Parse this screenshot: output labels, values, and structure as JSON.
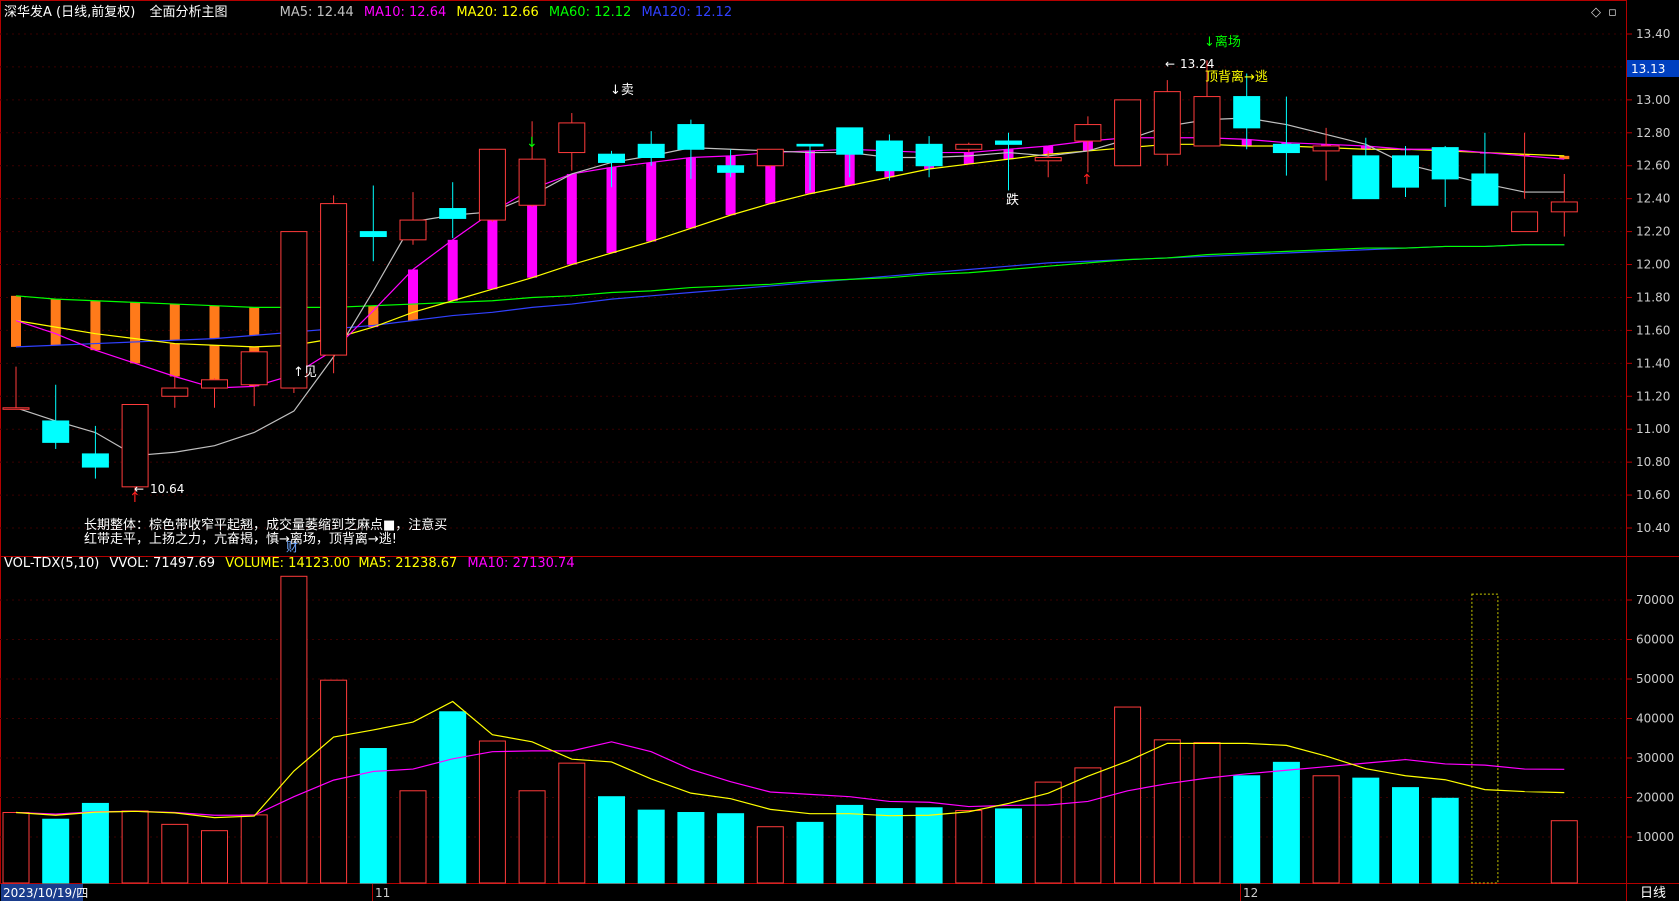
{
  "header": {
    "stock_title": "深华发A (日线,前复权)",
    "main_chart_label": "全面分析主图",
    "ma5": "MA5: 12.44",
    "ma10": "MA10: 12.64",
    "ma20": "MA20: 12.66",
    "ma60": "MA60: 12.12",
    "ma120": "MA120: 12.12"
  },
  "volume_header": {
    "indicator": "VOL-TDX(5,10)",
    "vvol": "VVOL: 71497.69",
    "volume": "VOLUME: 14123.00",
    "ma5": "MA5: 21238.67",
    "ma10": "MA10: 27130.74"
  },
  "colors": {
    "up": "#ff3b3b",
    "down": "#00ffff",
    "ma5": "#c0c0c0",
    "ma10": "#ff00ff",
    "ma20": "#ffff00",
    "ma60": "#00ff00",
    "ma120": "#3040ff",
    "axis": "#b40000",
    "current_price_bg": "#0040c0"
  },
  "price_axis": {
    "ticks": [
      "13.40",
      "13.20",
      "13.00",
      "12.80",
      "12.60",
      "12.40",
      "12.20",
      "12.00",
      "11.80",
      "11.60",
      "11.40",
      "11.20",
      "11.00",
      "10.80",
      "10.60",
      "10.40"
    ],
    "current_price": "13.13"
  },
  "volume_axis": {
    "ticks": [
      "70000",
      "60000",
      "50000",
      "40000",
      "30000",
      "20000",
      "10000"
    ]
  },
  "annotations": {
    "sell": "↓卖",
    "see": "↑见",
    "leave": "↓离场",
    "high": "13.24",
    "top_divergence": "顶背离→逃",
    "low": "10.64",
    "fall": "跌",
    "finance": "财",
    "tip_line1": "长期整体：棕色带收窄平起翘，成交量萎缩到芝麻点■，注意买",
    "tip_line2": "红带走平，上扬之力，亢奋揭，慎→离场，顶背离→逃!"
  },
  "date_axis": {
    "start_date": "2023/10/19/四",
    "month_nov": "11",
    "month_dec": "12",
    "period": "日线"
  },
  "chart_data": {
    "type": "candlestick",
    "x": [
      "2023-10-19",
      "2023-10-20",
      "2023-10-23",
      "2023-10-24",
      "2023-10-25",
      "2023-10-26",
      "2023-10-27",
      "2023-10-30",
      "2023-10-31",
      "2023-11-01",
      "2023-11-02",
      "2023-11-03",
      "2023-11-06",
      "2023-11-07",
      "2023-11-08",
      "2023-11-09",
      "2023-11-10",
      "2023-11-13",
      "2023-11-14",
      "2023-11-15",
      "2023-11-16",
      "2023-11-17",
      "2023-11-20",
      "2023-11-21",
      "2023-11-22",
      "2023-11-23",
      "2023-11-24",
      "2023-11-27",
      "2023-11-28",
      "2023-11-29",
      "2023-11-30",
      "2023-12-01",
      "2023-12-04",
      "2023-12-05",
      "2023-12-06",
      "2023-12-07",
      "2023-12-08",
      "2023-12-11",
      "2023-12-12",
      "2023-12-13"
    ],
    "open": [
      11.13,
      11.05,
      10.85,
      10.65,
      11.2,
      11.25,
      11.27,
      11.25,
      11.45,
      12.2,
      12.15,
      12.34,
      12.27,
      12.36,
      12.68,
      12.67,
      12.73,
      12.85,
      12.6,
      12.6,
      12.73,
      12.83,
      12.75,
      12.73,
      12.7,
      12.75,
      12.63,
      12.75,
      12.6,
      12.67,
      12.72,
      13.02,
      12.73,
      12.69,
      12.66,
      12.66,
      12.71,
      12.55,
      12.2,
      12.32
    ],
    "high": [
      11.38,
      11.27,
      11.02,
      11.15,
      11.32,
      11.31,
      11.47,
      11.5,
      12.42,
      12.48,
      12.44,
      12.5,
      12.7,
      12.87,
      12.92,
      12.69,
      12.81,
      12.88,
      12.7,
      12.61,
      12.73,
      12.8,
      12.79,
      12.78,
      12.74,
      12.8,
      12.69,
      12.9,
      12.98,
      13.12,
      13.24,
      13.16,
      13.02,
      12.83,
      12.77,
      12.72,
      12.72,
      12.8,
      12.8,
      12.55
    ],
    "low": [
      11.12,
      10.88,
      10.7,
      10.61,
      11.13,
      11.13,
      11.14,
      11.22,
      11.34,
      12.02,
      12.12,
      12.16,
      12.26,
      12.35,
      12.57,
      12.47,
      12.6,
      12.52,
      12.53,
      12.58,
      12.45,
      12.53,
      12.51,
      12.53,
      12.68,
      12.45,
      12.53,
      12.56,
      12.6,
      12.6,
      12.9,
      12.7,
      12.54,
      12.51,
      12.42,
      12.41,
      12.35,
      12.5,
      12.4,
      12.17
    ],
    "close": [
      11.13,
      10.92,
      10.77,
      11.15,
      11.25,
      11.3,
      11.47,
      12.2,
      12.37,
      12.17,
      12.27,
      12.28,
      12.7,
      12.64,
      12.86,
      12.62,
      12.65,
      12.7,
      12.56,
      12.7,
      12.72,
      12.67,
      12.57,
      12.6,
      12.73,
      12.73,
      12.65,
      12.85,
      13.0,
      13.05,
      13.02,
      12.83,
      12.68,
      12.72,
      12.4,
      12.47,
      12.52,
      12.36,
      12.32,
      12.38
    ],
    "volume": [
      16200,
      14500,
      18500,
      16600,
      13200,
      11600,
      15600,
      76000,
      49700,
      32400,
      21700,
      41700,
      34300,
      21700,
      28700,
      20200,
      16800,
      16200,
      15900,
      12600,
      13700,
      18000,
      17200,
      17400,
      16700,
      17100,
      23900,
      27500,
      42900,
      34600,
      33900,
      25500,
      28900,
      25500,
      24900,
      22500,
      19800,
      71497,
      0,
      14123
    ],
    "ma5": [
      11.13,
      11.05,
      10.98,
      10.84,
      10.86,
      10.9,
      10.98,
      11.11,
      11.44,
      11.84,
      12.26,
      12.3,
      12.32,
      12.42,
      12.55,
      12.62,
      12.66,
      12.71,
      12.7,
      12.69,
      12.68,
      12.68,
      12.65,
      12.65,
      12.66,
      12.68,
      12.66,
      12.69,
      12.76,
      12.84,
      12.88,
      12.89,
      12.85,
      12.79,
      12.73,
      12.61,
      12.55,
      12.49,
      12.44,
      12.44
    ],
    "ma10": [
      11.66,
      11.58,
      11.48,
      11.4,
      11.32,
      11.25,
      11.26,
      11.33,
      11.48,
      11.72,
      11.97,
      12.15,
      12.32,
      12.46,
      12.55,
      12.59,
      12.62,
      12.65,
      12.66,
      12.68,
      12.69,
      12.7,
      12.69,
      12.68,
      12.68,
      12.7,
      12.72,
      12.75,
      12.77,
      12.77,
      12.77,
      12.76,
      12.74,
      12.73,
      12.72,
      12.7,
      12.7,
      12.68,
      12.66,
      12.64
    ],
    "ma20": [
      11.66,
      11.62,
      11.58,
      11.55,
      11.52,
      11.51,
      11.5,
      11.51,
      11.55,
      11.62,
      11.71,
      11.78,
      11.85,
      11.92,
      12.0,
      12.07,
      12.14,
      12.22,
      12.3,
      12.37,
      12.43,
      12.48,
      12.53,
      12.58,
      12.61,
      12.64,
      12.67,
      12.69,
      12.71,
      12.73,
      12.73,
      12.72,
      12.72,
      12.71,
      12.7,
      12.7,
      12.69,
      12.68,
      12.67,
      12.66
    ],
    "ma60": [
      11.81,
      11.79,
      11.78,
      11.77,
      11.76,
      11.75,
      11.74,
      11.74,
      11.74,
      11.75,
      11.76,
      11.77,
      11.78,
      11.8,
      11.81,
      11.83,
      11.84,
      11.86,
      11.87,
      11.88,
      11.9,
      11.91,
      11.92,
      11.94,
      11.95,
      11.97,
      11.99,
      12.01,
      12.03,
      12.04,
      12.06,
      12.07,
      12.08,
      12.09,
      12.1,
      12.1,
      12.11,
      12.11,
      12.12,
      12.12
    ],
    "ma120": [
      11.5,
      11.51,
      11.52,
      11.53,
      11.54,
      11.55,
      11.57,
      11.59,
      11.61,
      11.63,
      11.66,
      11.69,
      11.71,
      11.74,
      11.76,
      11.79,
      11.81,
      11.83,
      11.85,
      11.87,
      11.89,
      11.91,
      11.93,
      11.95,
      11.97,
      11.99,
      12.01,
      12.02,
      12.03,
      12.04,
      12.05,
      12.06,
      12.07,
      12.08,
      12.09,
      12.1,
      12.11,
      12.11,
      12.12,
      12.12
    ],
    "vol_ma5": [
      16200,
      15500,
      16300,
      16500,
      16100,
      14900,
      15300,
      26700,
      35300,
      37100,
      39100,
      44300,
      35900,
      34100,
      29700,
      29000,
      24700,
      21100,
      19700,
      17000,
      15900,
      15900,
      15400,
      15500,
      16400,
      18500,
      21100,
      25400,
      29200,
      33700,
      33700,
      33700,
      33200,
      30500,
      27300,
      25500,
      24500,
      22000,
      21500,
      21239
    ],
    "vol_ma10": [
      16200,
      15800,
      16400,
      16500,
      16200,
      15500,
      15500,
      20200,
      24400,
      26600,
      27200,
      29800,
      31600,
      31800,
      31800,
      34100,
      31600,
      27100,
      24000,
      21400,
      20800,
      20200,
      19000,
      18800,
      17700,
      18000,
      18100,
      19000,
      21700,
      23500,
      24900,
      26000,
      26900,
      27800,
      28700,
      29600,
      28500,
      28200,
      27200,
      27131
    ],
    "ylim_price": [
      10.32,
      13.55
    ],
    "ylim_volume": [
      0,
      78000
    ]
  }
}
